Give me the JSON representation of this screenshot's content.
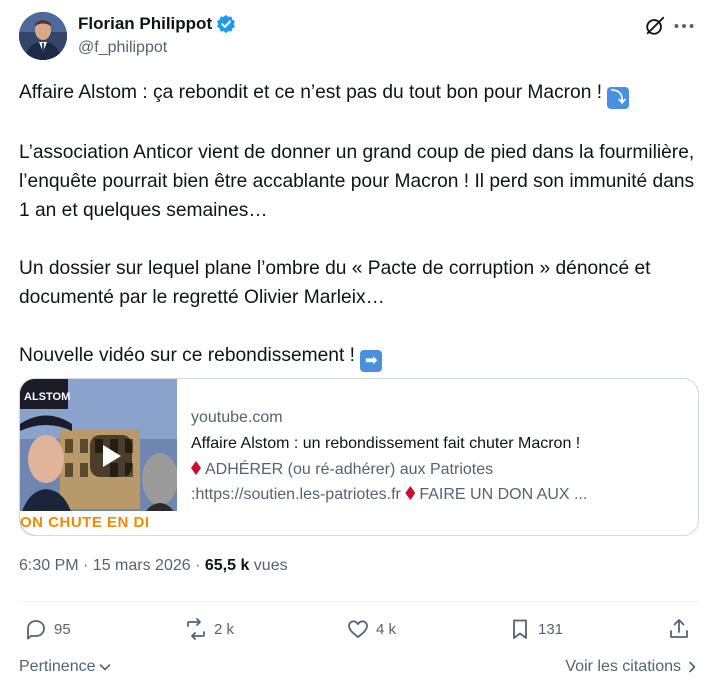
{
  "author": {
    "name": "Florian Philippot",
    "handle": "@f_philippot",
    "verified_color": "#1d9bf0"
  },
  "tweet": {
    "lines": [
      "Affaire Alstom : ça rebondit et ce n’est pas du tout bon pour Macron !",
      "L’association Anticor vient de donner un grand coup de pied dans la fourmilière, l’enquête pourrait bien être accablante pour Macron ! Il perd son immunité dans 1 an et quelques semaines…",
      "Un dossier sur lequel plane l’ombre du « Pacte de corruption » dénoncé et documenté par le regretté Olivier Marleix…",
      "Nouvelle vidéo sur ce rebondissement !"
    ],
    "emoji_down": "⤵",
    "emoji_right": "➡"
  },
  "card": {
    "domain": "youtube.com",
    "title": "Affaire Alstom : un rebondissement fait chuter Macron !",
    "desc_line1": "ADHÉRER (ou ré-adhérer) aux Patriotes",
    "desc_line2_a": ":https://soutien.les-patriotes.fr",
    "desc_line2_b": "FAIRE UN DON AUX ...",
    "thumb_caption": "ON CHUTE EN DI",
    "thumb_cap_text": "ALSTOM"
  },
  "meta": {
    "time": "6:30 PM · 15 mars 2026 · ",
    "views_count": "65,5 k",
    "views_label": " vues"
  },
  "actions": {
    "replies": "95",
    "reposts": "2 k",
    "likes": "4 k",
    "bookmarks": "131"
  },
  "footer": {
    "sort_label": "Pertinence",
    "quotes_label": "Voir les citations"
  }
}
